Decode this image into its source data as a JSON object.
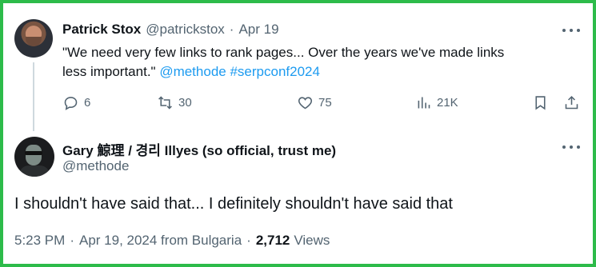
{
  "tweet1": {
    "author_name": "Patrick Stox",
    "handle": "@patrickstox",
    "separator": "·",
    "date": "Apr 19",
    "text_lines": [
      "\"We need very few links to rank pages... Over the years we've made links",
      "less important.\""
    ],
    "mention": "@methode",
    "hashtag": "#serpconf2024",
    "stats": {
      "replies": "6",
      "reposts": "30",
      "likes": "75",
      "views": "21K"
    }
  },
  "tweet2": {
    "author_name": "Gary 鯨理 / 경리 Illyes (so official, trust me)",
    "handle": "@methode",
    "text": "I shouldn't have said that... I definitely shouldn't have said that",
    "time": "5:23 PM",
    "separator": "·",
    "date": "Apr 19, 2024 from Bulgaria",
    "views_count": "2,712",
    "views_label": "Views"
  },
  "colors": {
    "frame_border": "#2dbb4a",
    "link": "#1d9bf0",
    "muted_text": "#536471",
    "primary_text": "#0f1419"
  },
  "icons": [
    "more-icon",
    "reply-icon",
    "repost-icon",
    "like-icon",
    "views-icon",
    "bookmark-icon",
    "share-icon"
  ]
}
